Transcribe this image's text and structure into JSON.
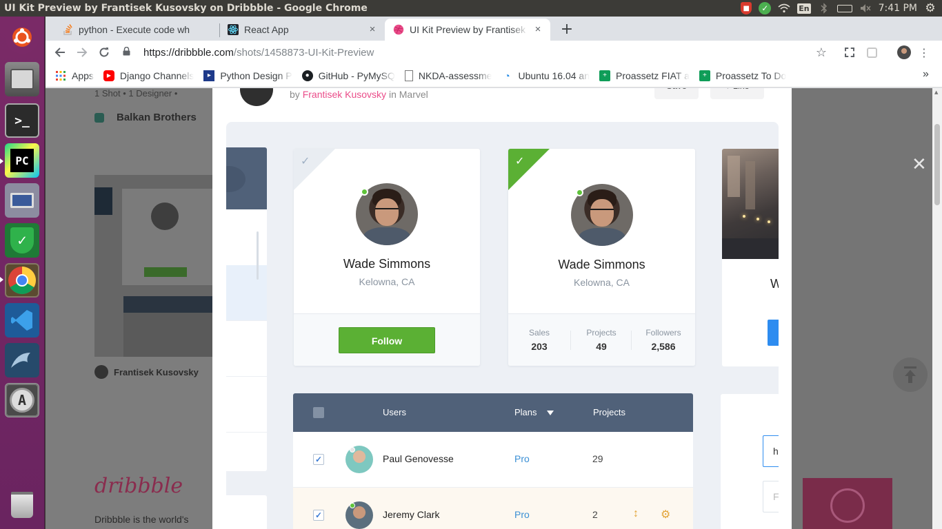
{
  "window": {
    "title": "UI Kit Preview by Frantisek Kusovsky on Dribbble - Google Chrome"
  },
  "tray": {
    "keyboard": "En",
    "clock": "7:41 PM"
  },
  "launcher": {
    "items": [
      {
        "name": "ubuntu-dash",
        "label": ""
      },
      {
        "name": "files",
        "label": ""
      },
      {
        "name": "terminal",
        "label": ">_"
      },
      {
        "name": "pycharm",
        "label": "PC"
      },
      {
        "name": "remote-desktop",
        "label": ""
      },
      {
        "name": "security",
        "label": "✓"
      },
      {
        "name": "chrome",
        "label": ""
      },
      {
        "name": "vscode",
        "label": ""
      },
      {
        "name": "mysql-workbench",
        "label": ""
      },
      {
        "name": "software-updater",
        "label": "A"
      },
      {
        "name": "trash",
        "label": ""
      }
    ]
  },
  "tabs": [
    {
      "title": "python - Execute code wh",
      "icon": "stackoverflow-icon",
      "close": "×"
    },
    {
      "title": "React App",
      "icon": "react-icon",
      "close": "×"
    },
    {
      "title": "UI Kit Preview by Frantisek",
      "icon": "dribbble-icon",
      "close": "×"
    }
  ],
  "newtab": "+",
  "omnibox": {
    "host": "https://dribbble.com",
    "path": "/shots/1458873-UI-Kit-Preview"
  },
  "bookmarks": [
    {
      "label": "Apps"
    },
    {
      "label": "Django Channels"
    },
    {
      "label": "Python Design P"
    },
    {
      "label": "GitHub - PyMySQ"
    },
    {
      "label": "NKDA-assessme"
    },
    {
      "label": "Ubuntu 16.04 an"
    },
    {
      "label": "Proassetz FIAT a"
    },
    {
      "label": "Proassetz To Do"
    }
  ],
  "bookmarks_more": "»",
  "background": {
    "shot_info": "1 Shot • 1 Designer •",
    "team": "Balkan Brothers",
    "author": "Frantisek Kusovsky",
    "logo": "dribbble",
    "description": "Dribbble is the world's"
  },
  "modal": {
    "by": "by",
    "author": "Frantisek Kusovsky",
    "in": "in",
    "team": "Marvel",
    "save_label": "Save",
    "like_label": "♥ Like"
  },
  "profile_cards": [
    {
      "name": "Wade Simmons",
      "location": "Kelowna, CA",
      "follow": "Follow"
    },
    {
      "name": "Wade Simmons",
      "location": "Kelowna, CA",
      "stats": [
        {
          "label": "Sales",
          "value": "203"
        },
        {
          "label": "Projects",
          "value": "49"
        },
        {
          "label": "Followers",
          "value": "2,586"
        }
      ]
    }
  ],
  "right_card": {
    "initial": "W"
  },
  "right_input": {
    "value": "h",
    "placeholder": "F"
  },
  "table": {
    "headers": {
      "users": "Users",
      "plans": "Plans",
      "projects": "Projects"
    },
    "rows": [
      {
        "name": "Paul Genovesse",
        "plan": "Pro",
        "projects": "29",
        "checked": "✓"
      },
      {
        "name": "Jeremy Clark",
        "plan": "Pro",
        "projects": "2",
        "checked": "✓",
        "sort": "↕",
        "settings": "⚙"
      }
    ]
  },
  "colors": {
    "accent_pink": "#ea4c89",
    "follow_green": "#5bb034",
    "table_header": "#506179",
    "plan_blue": "#3a8fd5"
  }
}
